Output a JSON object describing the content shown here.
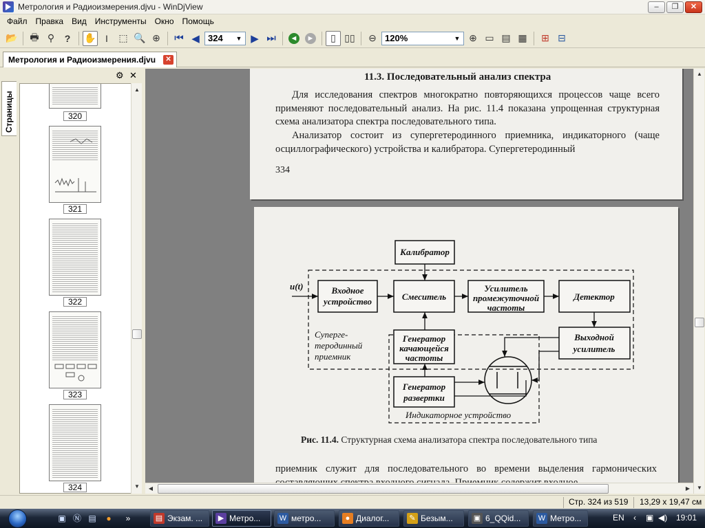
{
  "window": {
    "title": "Метрология и Радиоизмерения.djvu - WinDjView"
  },
  "menu": [
    "Файл",
    "Правка",
    "Вид",
    "Инструменты",
    "Окно",
    "Помощь"
  ],
  "toolbar": {
    "page_value": "324",
    "zoom_value": "120%"
  },
  "tab": {
    "label": "Метрология и Радиоизмерения.djvu"
  },
  "sidebar": {
    "tab_label": "Страницы",
    "thumbnails": [
      "320",
      "321",
      "322",
      "323",
      "324"
    ]
  },
  "page_top": {
    "section_title": "11.3. Последовательный анализ спектра",
    "para1": "Для исследования спектров многократно повторяющихся процессов чаще всего применяют последовательный анализ. На рис. 11.4 показана упрощенная структурная схема анализатора спектра последовательного типа.",
    "para2": "Анализатор состоит из супергетеродинного приемника, индикаторного (чаще осциллографического) устройства и калибратора. Супергетеродинный",
    "page_number": "334"
  },
  "diagram": {
    "input": "u(t)",
    "blocks": {
      "calibrator": "Калибратор",
      "input_device": [
        "Входное",
        "устройство"
      ],
      "mixer": "Смеситель",
      "if_amplifier": [
        "Усилитель",
        "промежуточной",
        "частоты"
      ],
      "detector": "Детектор",
      "sweep_gen": [
        "Генератор",
        "качающейся",
        "частоты"
      ],
      "output_amp": [
        "Выходной",
        "усилитель"
      ],
      "scan_gen": [
        "Генератор",
        "развертки"
      ]
    },
    "group_receiver": [
      "Суперге-",
      "теродинный",
      "приемник"
    ],
    "group_indicator": "Индикаторное устройство"
  },
  "page_main": {
    "caption_bold": "Рис. 11.4.",
    "caption_text": " Структурная схема анализатора спектра последовательного типа",
    "para3": "приемник служит для последовательного во времени выделения гармонических составляющих спектра входного сигнала. Приемник содержит входное"
  },
  "status": {
    "page_info": "Стр. 324 из 519",
    "page_size": "13,29 x 19,47 см"
  },
  "taskbar": {
    "tasks": [
      "Экзам. ...",
      "Метро...",
      "метро...",
      "Диалог...",
      "Безым...",
      "6_QQid...",
      "Метро..."
    ],
    "lang": "EN",
    "clock": "19:01"
  },
  "colors": {
    "taskbar": "#1d2738",
    "view_bg": "#808080",
    "page_bg": "#f1f0ec"
  }
}
